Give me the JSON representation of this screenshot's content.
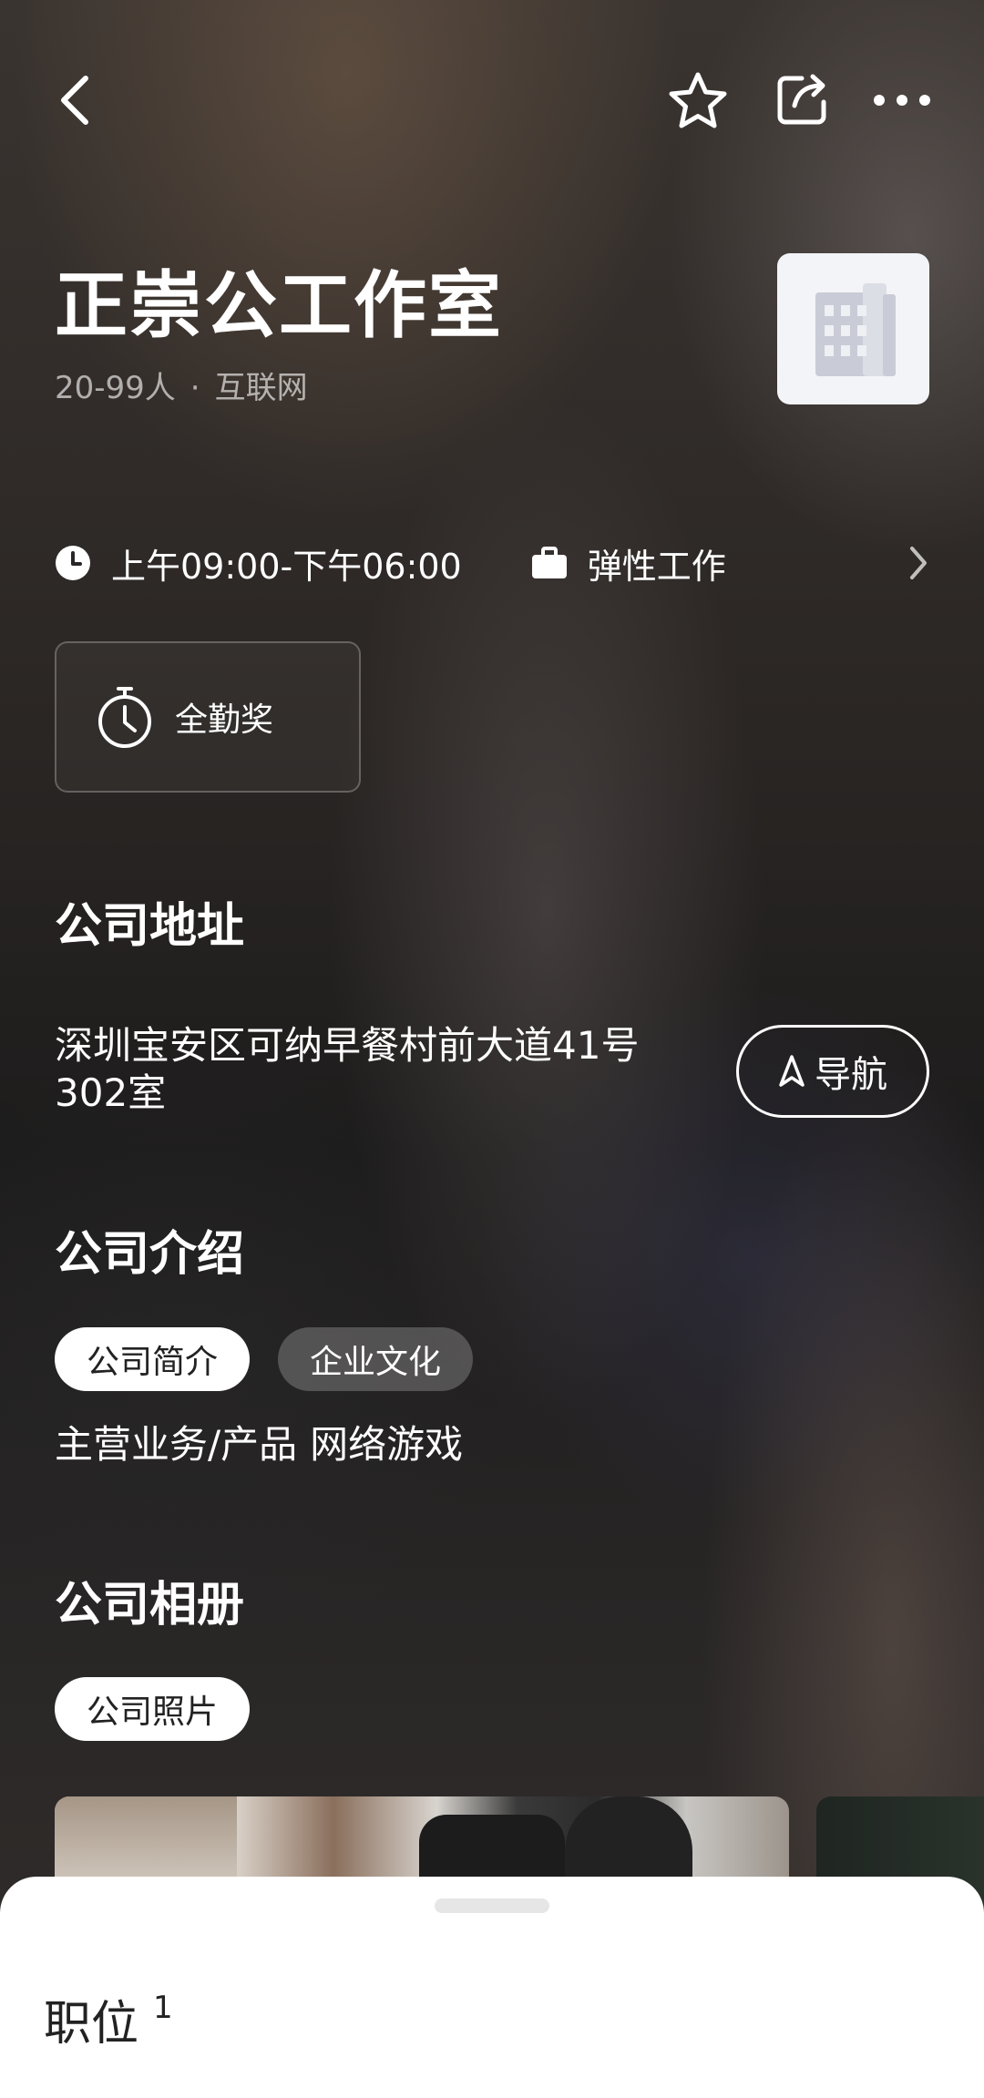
{
  "company": {
    "name": "正崇公工作室",
    "size": "20-99人",
    "separator": "·",
    "industry": "互联网"
  },
  "info": {
    "work_hours": "上午09:00-下午06:00",
    "work_type": "弹性工作"
  },
  "welfare": {
    "items": [
      "全勤奖"
    ]
  },
  "address_section": {
    "title": "公司地址",
    "address_line1": "深圳宝安区可纳早餐村前大道41号",
    "address_line2": "302室",
    "nav_label": "导航"
  },
  "intro_section": {
    "title": "公司介绍",
    "tabs": [
      {
        "label": "公司简介",
        "active": true
      },
      {
        "label": "企业文化",
        "active": false
      }
    ],
    "business_label": "主营业务/产品",
    "business_value": "网络游戏"
  },
  "album_section": {
    "title": "公司相册",
    "tab_label": "公司照片"
  },
  "bottom_sheet": {
    "title": "职位",
    "count": "1"
  }
}
